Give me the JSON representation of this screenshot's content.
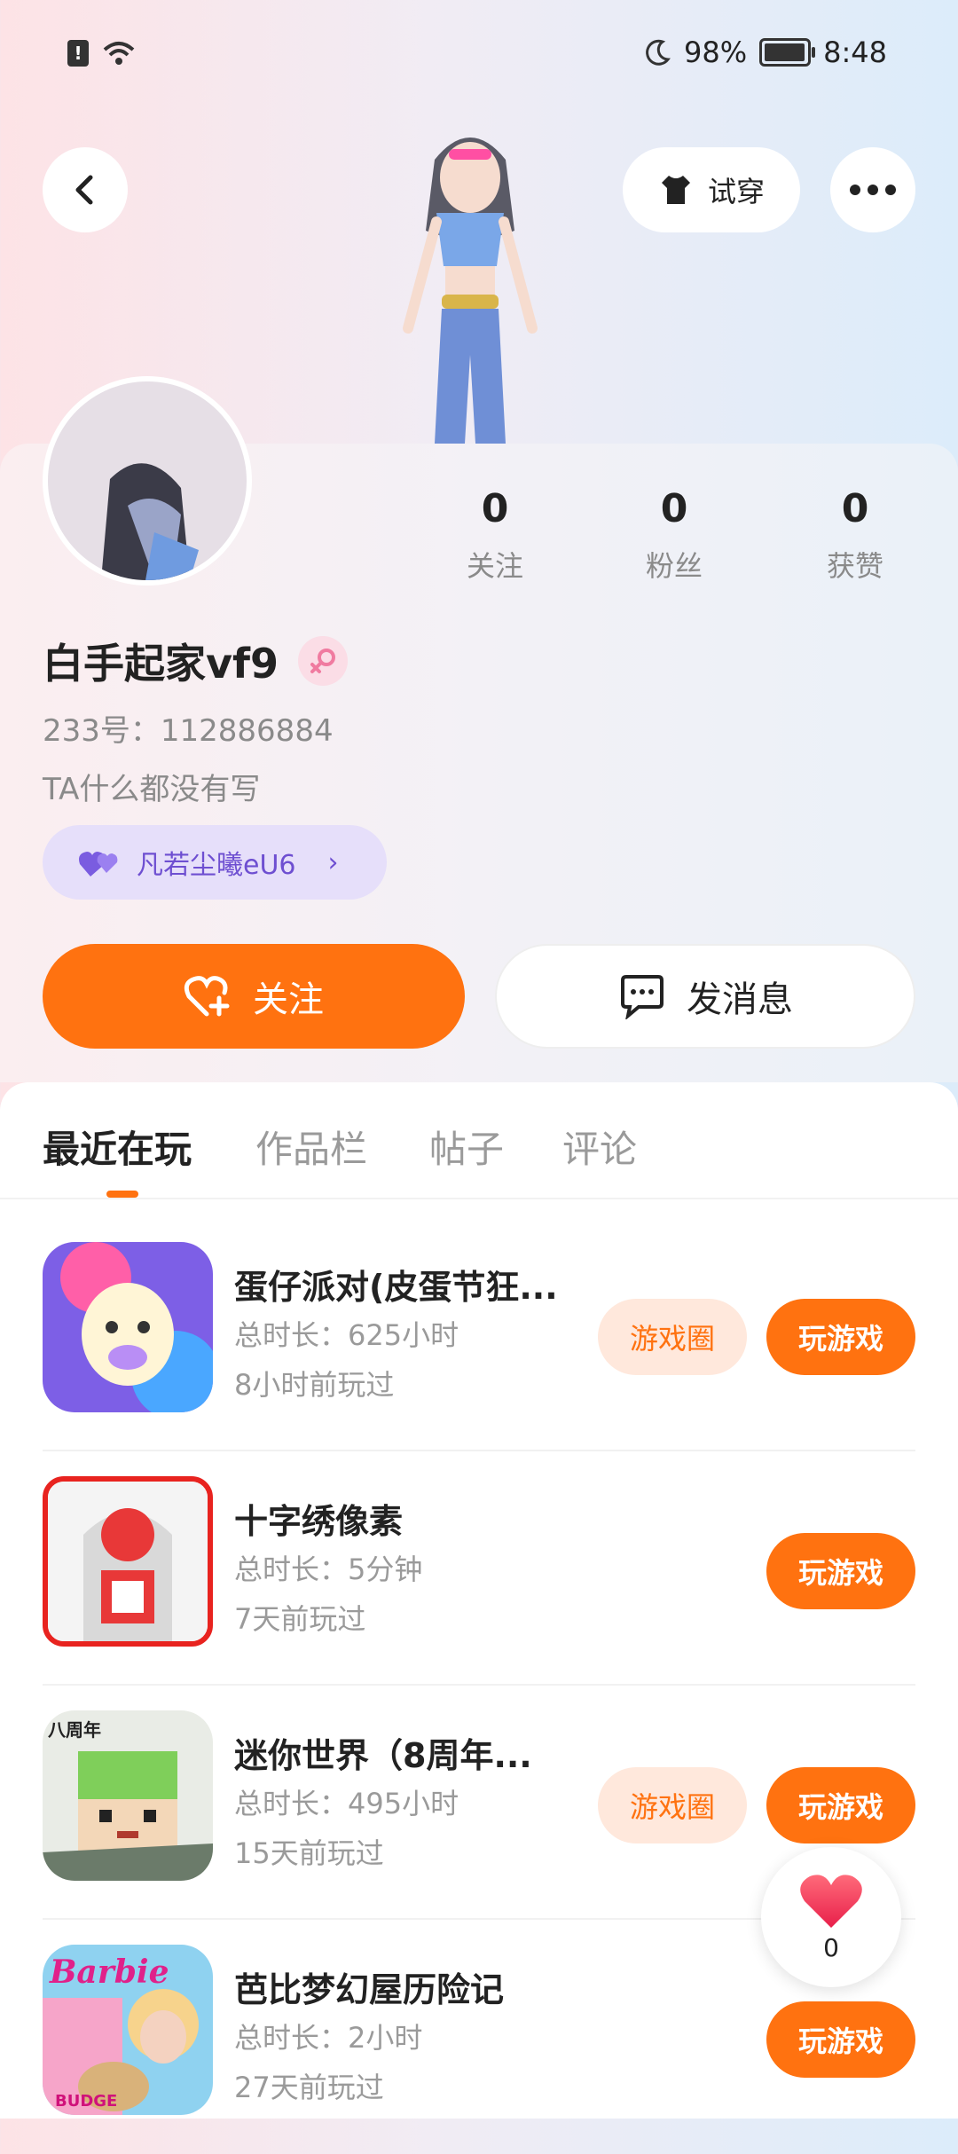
{
  "status_bar": {
    "battery_pct": "98%",
    "battery_level": 0.98,
    "time": "8:48"
  },
  "top": {
    "try_on_label": "试穿"
  },
  "profile": {
    "stats": [
      {
        "value": "0",
        "label": "关注"
      },
      {
        "value": "0",
        "label": "粉丝"
      },
      {
        "value": "0",
        "label": "获赞"
      }
    ],
    "name": "白手起家vf9",
    "id_line": "233号：112886884",
    "bio": "TA什么都没有写",
    "friend_tag": "凡若尘曦eU6"
  },
  "actions": {
    "follow_label": "关注",
    "message_label": "发消息"
  },
  "tabs": [
    "最近在玩",
    "作品栏",
    "帖子",
    "评论"
  ],
  "games": [
    {
      "title": "蛋仔派对(皮蛋节狂...",
      "duration": "总时长：625小时",
      "last": "8小时前玩过",
      "circle_label": "游戏圈",
      "play_label": "玩游戏"
    },
    {
      "title": "十字绣像素",
      "duration": "总时长：5分钟",
      "last": "7天前玩过",
      "play_label": "玩游戏"
    },
    {
      "title": "迷你世界（8周年...",
      "duration": "总时长：495小时",
      "last": "15天前玩过",
      "circle_label": "游戏圈",
      "play_label": "玩游戏"
    },
    {
      "title": "芭比梦幻屋历险记",
      "duration": "总时长：2小时",
      "last": "27天前玩过",
      "play_label": "玩游戏"
    }
  ],
  "icon_labels": {
    "barbie_brand": "Barbie",
    "barbie_sub": "BUDGE",
    "mini_world_badge": "八周年"
  },
  "like": {
    "count": "0"
  },
  "colors": {
    "accent": "#ff7210",
    "friend_tag": "#6e4fd1"
  }
}
